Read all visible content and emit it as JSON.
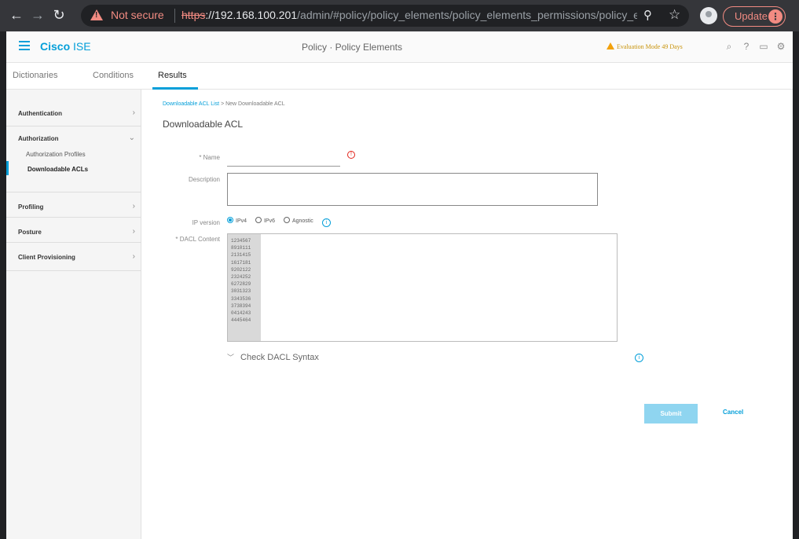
{
  "browser": {
    "not_secure": "Not secure",
    "url_scheme": "https",
    "url_host": "://192.168.100.201",
    "url_path": "/admin/#policy/policy_elements/policy_elements_permissions/policy_el...",
    "update_label": "Update"
  },
  "header": {
    "brand_bold": "Cisco",
    "brand_rest": " ISE",
    "title": "Policy · Policy Elements",
    "eval_text": "Evaluation Mode 49 Days"
  },
  "tabs": {
    "dictionaries": "Dictionaries",
    "conditions": "Conditions",
    "results": "Results"
  },
  "sidebar": {
    "authentication": "Authentication",
    "authorization": "Authorization",
    "authorization_profiles": "Authorization Profiles",
    "downloadable_acls": "Downloadable ACLs",
    "profiling": "Profiling",
    "posture": "Posture",
    "client_provisioning": "Client Provisioning"
  },
  "breadcrumb": {
    "link": "Downloadable ACL List",
    "separator": " > ",
    "current": "New Downloadable ACL"
  },
  "form": {
    "title": "Downloadable ACL",
    "name_label": "* Name",
    "description_label": "Description",
    "ip_version_label": "IP version",
    "ipv4": "IPv4",
    "ipv6": "IPv6",
    "agnostic": "Agnostic",
    "dacl_label": "* DACL Content",
    "line_numbers": [
      "1234567",
      "8910111",
      "2131415",
      "1617181",
      "9202122",
      "2324252",
      "6272829",
      "3031323",
      "3343536",
      "3738394",
      "0414243",
      "4445464"
    ],
    "check_syntax": "Check DACL Syntax",
    "submit": "Submit",
    "cancel": "Cancel"
  }
}
